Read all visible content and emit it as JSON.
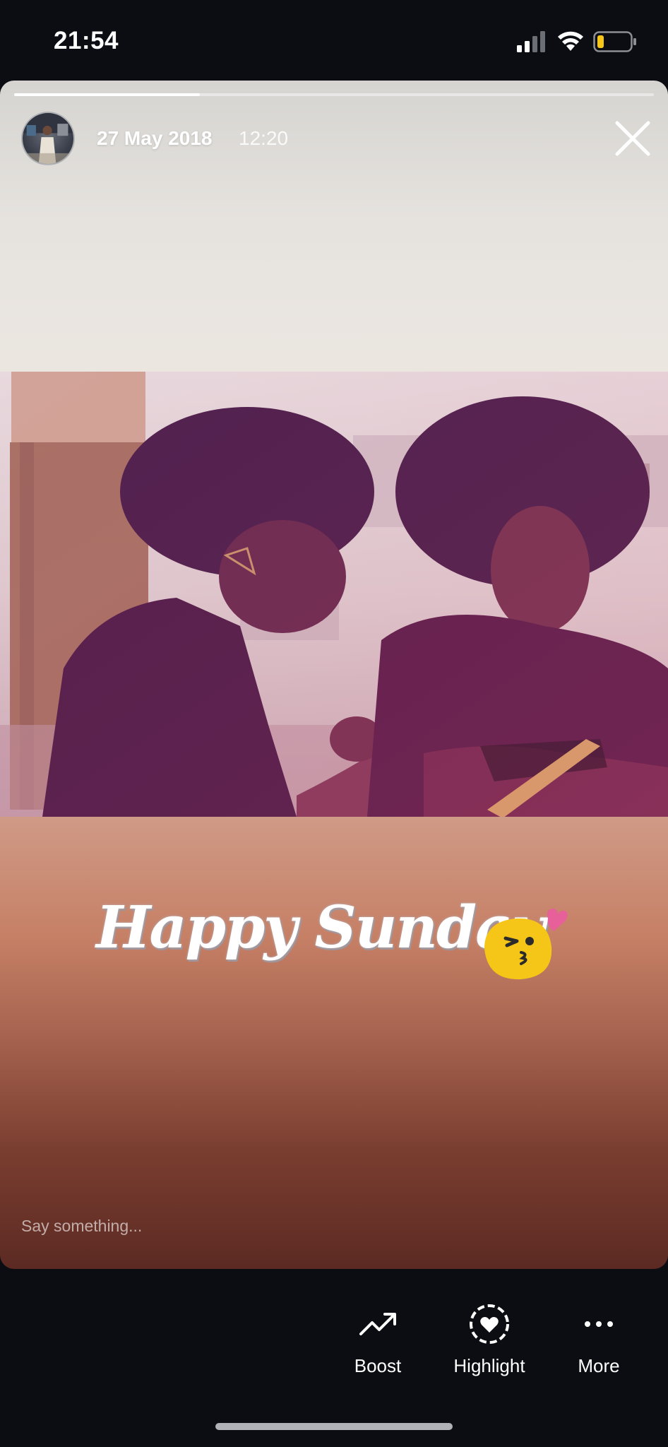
{
  "status_bar": {
    "time": "21:54",
    "icons": [
      "cellular-signal-icon",
      "wifi-icon",
      "battery-low-icon"
    ],
    "battery_color": "#f5c518"
  },
  "story": {
    "progress": 0.29,
    "date": "27 May 2018",
    "time": "12:20",
    "close_icon": "close-icon",
    "sticker_text": "Happy Sunday",
    "sticker_emoji": "kissing-face-emoji",
    "comment_placeholder": "Say something..."
  },
  "actions": [
    {
      "label": "Boost",
      "icon": "trending-up-icon"
    },
    {
      "label": "Highlight",
      "icon": "highlight-heart-icon"
    },
    {
      "label": "More",
      "icon": "more-dots-icon"
    }
  ],
  "colors": {
    "background": "#0b0d12",
    "accent_pink": "#e8609a"
  }
}
